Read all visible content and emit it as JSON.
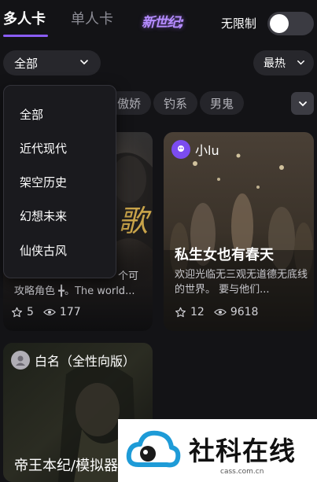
{
  "header": {
    "tabs": [
      {
        "label": "多人卡",
        "active": true
      },
      {
        "label": "单人卡",
        "active": false
      }
    ],
    "logo_text": "新世纪;",
    "no_limit_label": "无限制",
    "no_limit_enabled": false
  },
  "filters": {
    "category_selected": "全部",
    "sort_label": "最热"
  },
  "tags": [
    "傲娇",
    "钓系",
    "男鬼"
  ],
  "category_dropdown": {
    "open": true,
    "options": [
      "全部",
      "近代现代",
      "架空历史",
      "幻想未来",
      "仙侠古风"
    ]
  },
  "cards": [
    {
      "title": "",
      "description_fragment": "个可",
      "description_line2": "攻略角色 ╋。The world...",
      "overlay_text": "歌",
      "stars": "5",
      "views": "177"
    },
    {
      "author": "小lu",
      "title": "私生女也有春天",
      "description": "欢迎光临无三观无道德无底线的世界。 要与他们...",
      "stars": "12",
      "views": "9618"
    },
    {
      "author": "白名（全性向版）",
      "title": "帝王本纪/模拟器"
    }
  ],
  "watermark": {
    "text": "社科在线",
    "url": "cass.com.cn"
  },
  "colors": {
    "accent": "#8a5cf6",
    "background": "#131316",
    "pill": "#27272c"
  }
}
